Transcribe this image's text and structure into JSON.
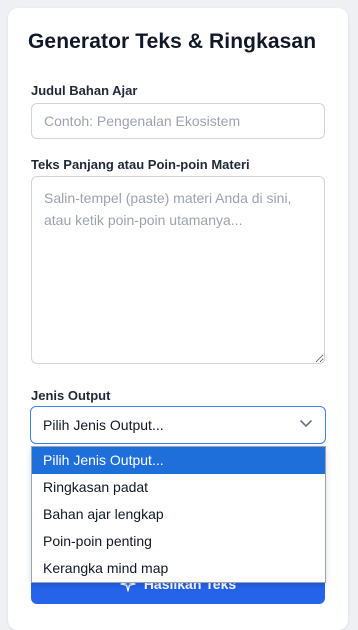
{
  "form": {
    "title": "Generator Teks & Ringkasan",
    "judul_label": "Judul Bahan Ajar",
    "judul_placeholder": "Contoh: Pengenalan Ekosistem",
    "judul_value": "",
    "teks_label": "Teks Panjang atau Poin-poin Materi",
    "teks_placeholder": "Salin-tempel (paste) materi Anda di sini, atau ketik poin-poin utamanya...",
    "teks_value": "",
    "output_label": "Jenis Output",
    "output_selected": "Pilih Jenis Output...",
    "output_options": [
      "Pilih Jenis Output...",
      "Ringkasan padat",
      "Bahan ajar lengkap",
      "Poin-poin penting",
      "Kerangka mind map"
    ],
    "submit_label": "Hasilkan Teks"
  },
  "colors": {
    "accent": "#2563eb",
    "option_highlight": "#1e6fd9",
    "background": "#eef0f3"
  },
  "icons": {
    "select_caret": "chevron-down-icon",
    "submit": "sparkles-icon"
  }
}
